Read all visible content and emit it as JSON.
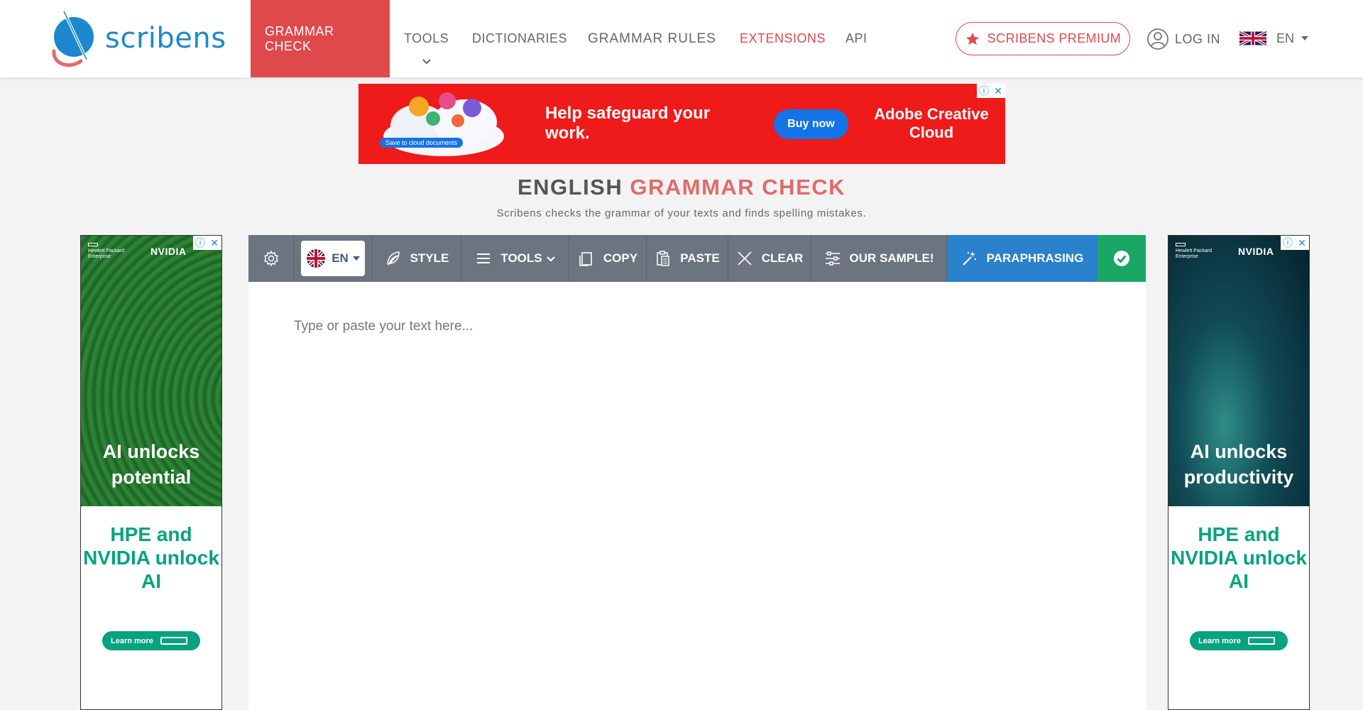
{
  "logo": {
    "text": "scribens"
  },
  "nav": {
    "grammar_check": "GRAMMAR CHECK",
    "tools": "TOOLS",
    "dictionaries": "DICTIONARIES",
    "grammar_rules": "GRAMMAR RULES",
    "extensions": "EXTENSIONS",
    "api": "API",
    "premium": "SCRIBENS PREMIUM",
    "login": "LOG IN",
    "language": "EN"
  },
  "banner_ad": {
    "headline": "Help safeguard your work.",
    "button": "Buy now",
    "brand": "Adobe Creative Cloud",
    "tag": "Save to cloud documents"
  },
  "heading": {
    "title_part1": "ENGLISH",
    "title_part2": "GRAMMAR CHECK",
    "subtitle": "Scribens checks the grammar of your texts and finds spelling mistakes."
  },
  "side_ads": {
    "left": {
      "hpe": "Hewlett Packard Enterprise",
      "nvidia": "NVIDIA",
      "visual_text": "AI unlocks potential",
      "green_text": "HPE and NVIDIA unlock AI",
      "cta": "Learn more"
    },
    "right": {
      "hpe": "Hewlett Packard Enterprise",
      "nvidia": "NVIDIA",
      "visual_text": "AI unlocks productivity",
      "green_text": "HPE and NVIDIA unlock AI",
      "cta": "Learn more"
    }
  },
  "toolbar": {
    "language": "EN",
    "style": "STYLE",
    "tools": "TOOLS",
    "copy": "COPY",
    "paste": "PASTE",
    "clear": "CLEAR",
    "sample": "OUR SAMPLE!",
    "paraphrasing": "PARAPHRASING"
  },
  "editor": {
    "placeholder": "Type or paste your text here...",
    "value": ""
  },
  "colors": {
    "accent_red": "#e0494b",
    "toolbar_gray": "#6c7480",
    "paraphrase_blue": "#2a81cc",
    "check_green": "#1aa765",
    "logo_blue": "#1d88cf"
  }
}
